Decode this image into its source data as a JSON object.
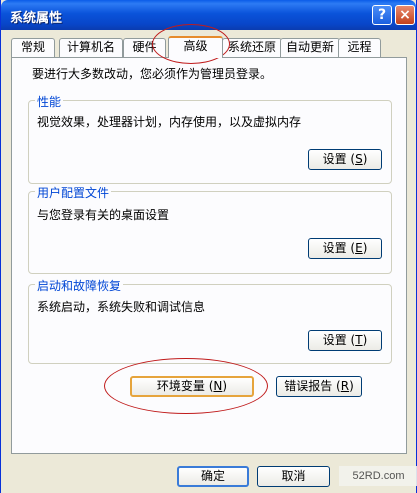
{
  "window": {
    "title": "系统属性",
    "help_glyph": "?",
    "close_glyph": "×"
  },
  "tabs": [
    {
      "label": "常规"
    },
    {
      "label": "计算机名"
    },
    {
      "label": "硬件"
    },
    {
      "label": "高级"
    },
    {
      "label": "系统还原"
    },
    {
      "label": "自动更新"
    },
    {
      "label": "远程"
    }
  ],
  "panel": {
    "intro": "要进行大多数改动，您必须作为管理员登录。"
  },
  "groups": {
    "performance": {
      "title": "性能",
      "desc": "视觉效果，处理器计划，内存使用，以及虚拟内存",
      "button": "设置",
      "key": "S"
    },
    "profiles": {
      "title": "用户配置文件",
      "desc": "与您登录有关的桌面设置",
      "button": "设置",
      "key": "E"
    },
    "startup": {
      "title": "启动和故障恢复",
      "desc": "系统启动，系统失败和调试信息",
      "button": "设置",
      "key": "T"
    }
  },
  "env_button": {
    "label": "环境变量",
    "key": "N"
  },
  "error_button": {
    "label": "错误报告",
    "key": "R"
  },
  "footer": {
    "ok": "确定",
    "cancel": "取消"
  },
  "watermark": "52RD.com"
}
